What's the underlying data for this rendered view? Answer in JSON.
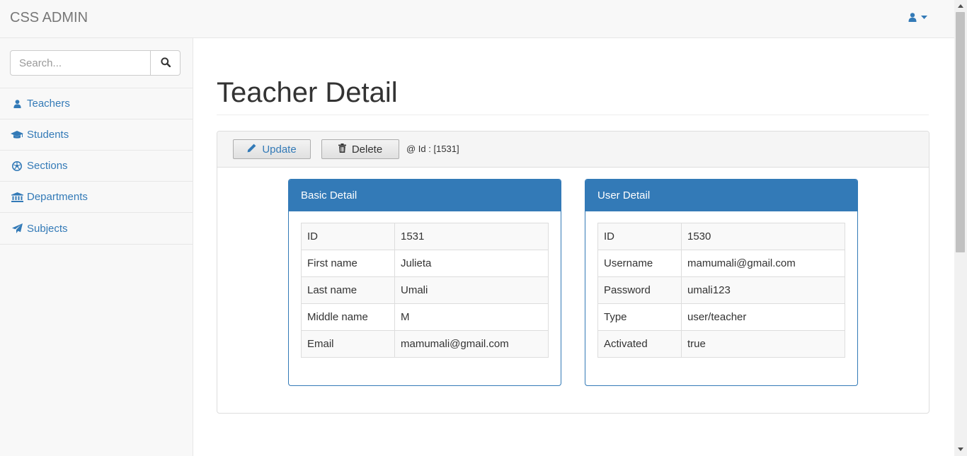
{
  "app": {
    "brand": "CSS ADMIN"
  },
  "sidebar": {
    "search_placeholder": "Search...",
    "items": [
      {
        "label": "Teachers",
        "icon": "user-icon"
      },
      {
        "label": "Students",
        "icon": "graduation-cap-icon"
      },
      {
        "label": "Sections",
        "icon": "soccer-ball-icon"
      },
      {
        "label": "Departments",
        "icon": "institution-icon"
      },
      {
        "label": "Subjects",
        "icon": "paper-plane-icon"
      }
    ]
  },
  "main": {
    "title": "Teacher Detail",
    "actions": {
      "update_label": "Update",
      "delete_label": "Delete",
      "id_text": "@ Id : [1531]"
    },
    "basic_detail": {
      "title": "Basic Detail",
      "rows": [
        {
          "label": "ID",
          "value": "1531"
        },
        {
          "label": "First name",
          "value": "Julieta"
        },
        {
          "label": "Last name",
          "value": "Umali"
        },
        {
          "label": "Middle name",
          "value": "M"
        },
        {
          "label": "Email",
          "value": "mamumali@gmail.com"
        }
      ]
    },
    "user_detail": {
      "title": "User Detail",
      "rows": [
        {
          "label": "ID",
          "value": "1530"
        },
        {
          "label": "Username",
          "value": "mamumali@gmail.com"
        },
        {
          "label": "Password",
          "value": "umali123"
        },
        {
          "label": "Type",
          "value": "user/teacher"
        },
        {
          "label": "Activated",
          "value": "true"
        }
      ]
    }
  },
  "colors": {
    "primary": "#337ab7",
    "navbar_bg": "#f8f8f8",
    "border": "#e7e7e7"
  }
}
